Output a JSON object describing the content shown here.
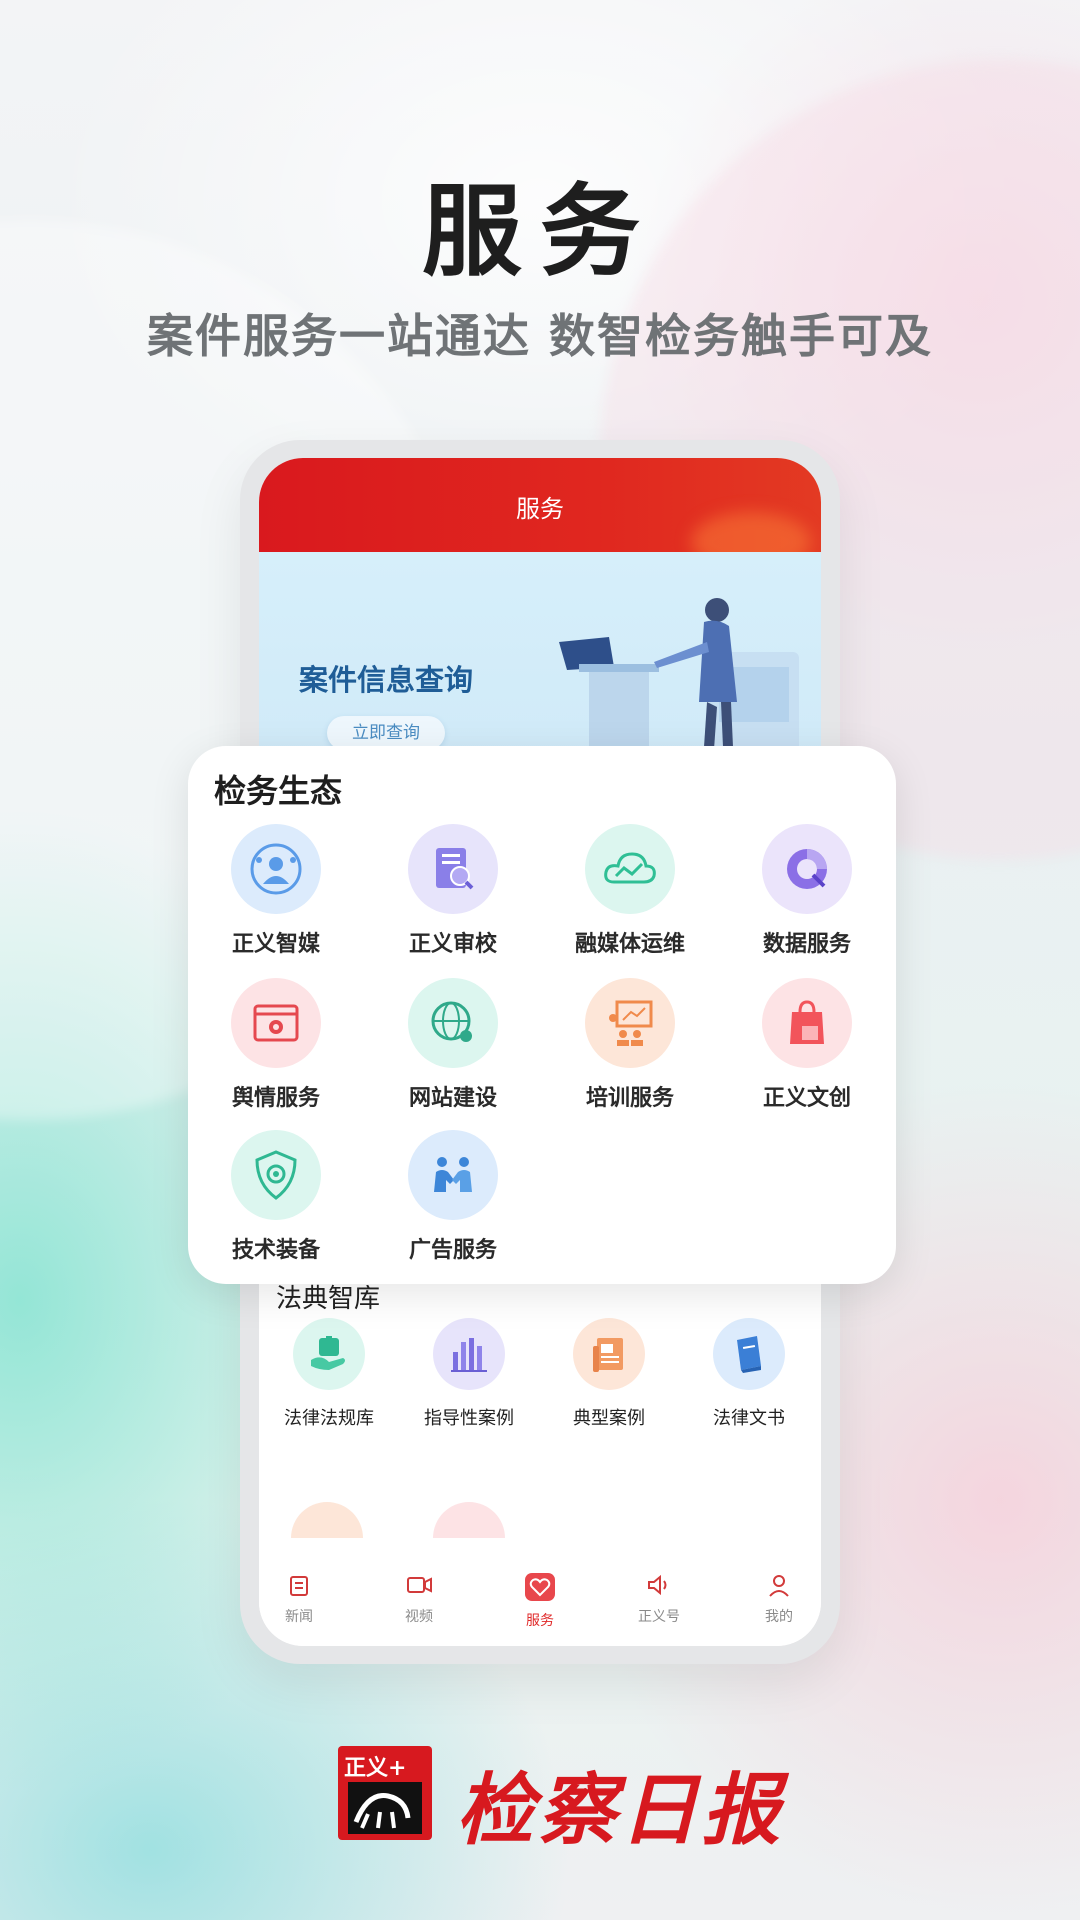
{
  "promo": {
    "headline": "服务",
    "subline": "案件服务一站通达  数智检务触手可及"
  },
  "app": {
    "header_title": "服务",
    "banner": {
      "title": "案件信息查询",
      "button": "立即查询"
    },
    "ecosystem": {
      "title": "检务生态",
      "items": [
        {
          "label": "正义智媒",
          "icon": "smart-media-icon",
          "color": "#dcebfc"
        },
        {
          "label": "正义审校",
          "icon": "proofread-icon",
          "color": "#e7e4fb"
        },
        {
          "label": "融媒体运维",
          "icon": "cloud-ops-icon",
          "color": "#dcf6ef"
        },
        {
          "label": "数据服务",
          "icon": "data-service-icon",
          "color": "#ebe4fb"
        },
        {
          "label": "舆情服务",
          "icon": "public-opinion-icon",
          "color": "#fde3e5"
        },
        {
          "label": "网站建设",
          "icon": "website-icon",
          "color": "#dcf6ef"
        },
        {
          "label": "培训服务",
          "icon": "training-icon",
          "color": "#fde6d8"
        },
        {
          "label": "正义文创",
          "icon": "shopping-bag-icon",
          "color": "#fde3e5"
        },
        {
          "label": "技术装备",
          "icon": "shield-icon",
          "color": "#dcf6ef"
        },
        {
          "label": "广告服务",
          "icon": "handshake-icon",
          "color": "#dcebfc"
        }
      ]
    },
    "law": {
      "title": "法典智库",
      "items": [
        {
          "label": "法律法规库",
          "icon": "law-library-icon",
          "color": "#dcf6ef"
        },
        {
          "label": "指导性案例",
          "icon": "bar-chart-icon",
          "color": "#e7e4fb"
        },
        {
          "label": "典型案例",
          "icon": "document-icon",
          "color": "#fde6d8"
        },
        {
          "label": "法律文书",
          "icon": "book-icon",
          "color": "#dcebfc"
        }
      ]
    },
    "tabs": [
      {
        "label": "新闻",
        "icon": "news-icon",
        "active": false
      },
      {
        "label": "视频",
        "icon": "video-icon",
        "active": false
      },
      {
        "label": "服务",
        "icon": "service-heart-icon",
        "active": true
      },
      {
        "label": "正义号",
        "icon": "speaker-icon",
        "active": false
      },
      {
        "label": "我的",
        "icon": "user-icon",
        "active": false
      }
    ]
  },
  "brand": {
    "badge_text": "正义+",
    "name": "检察日报",
    "accent": "#d7191f"
  }
}
